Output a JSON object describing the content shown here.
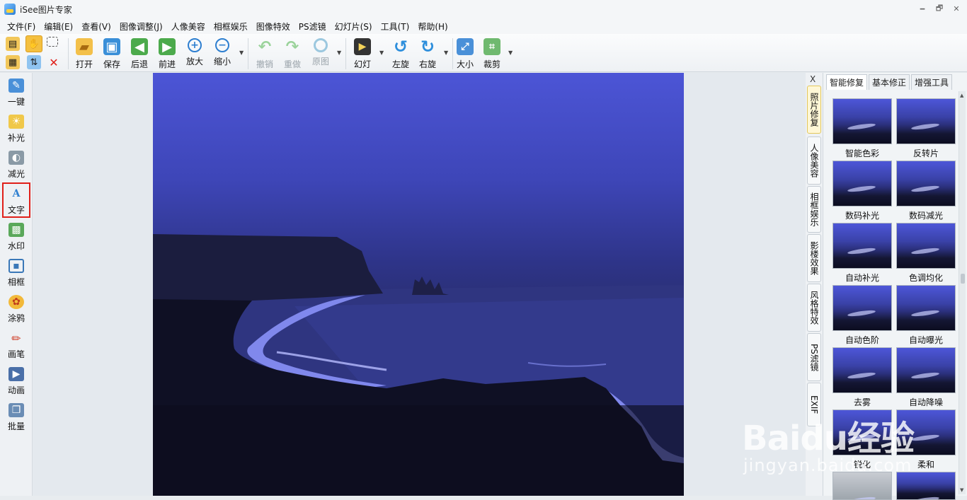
{
  "window": {
    "title": "iSee图片专家",
    "min": "🗕",
    "max": "🗗",
    "close": "✕"
  },
  "menu": [
    "文件(F)",
    "编辑(E)",
    "查看(V)",
    "图像调整(J)",
    "人像美容",
    "相框娱乐",
    "图像特效",
    "PS滤镜",
    "幻灯片(S)",
    "工具(T)",
    "帮助(H)"
  ],
  "toolbar": {
    "open": "打开",
    "save": "保存",
    "back": "后退",
    "forward": "前进",
    "zoom_in": "放大",
    "zoom_out": "缩小",
    "undo": "撤销",
    "redo": "重做",
    "original": "原图",
    "slideshow": "幻灯",
    "rotate_left": "左旋",
    "rotate_right": "右旋",
    "resize": "大小",
    "crop": "裁剪"
  },
  "leftbar": [
    "一键",
    "补光",
    "减光",
    "文字",
    "水印",
    "相框",
    "涂鸦",
    "画笔",
    "动画",
    "批量"
  ],
  "vtabs": {
    "close": "X",
    "items": [
      "照片修复",
      "人像美容",
      "相框娱乐",
      "影楼效果",
      "风格特效",
      "PS滤镜",
      "EXIF"
    ]
  },
  "panel": {
    "tabs": [
      "智能修复",
      "基本修正",
      "增强工具"
    ],
    "thumbs": [
      "智能色彩",
      "反转片",
      "数码补光",
      "数码减光",
      "自动补光",
      "色调均化",
      "自动色阶",
      "自动曝光",
      "去雾",
      "自动降噪",
      "锐化",
      "柔和"
    ]
  },
  "watermark": {
    "logo": "Baidu经验",
    "site": "jingyan.baidu.com"
  },
  "colors": {
    "sky_top": "#4c55d6",
    "accent": "#e0201a"
  }
}
